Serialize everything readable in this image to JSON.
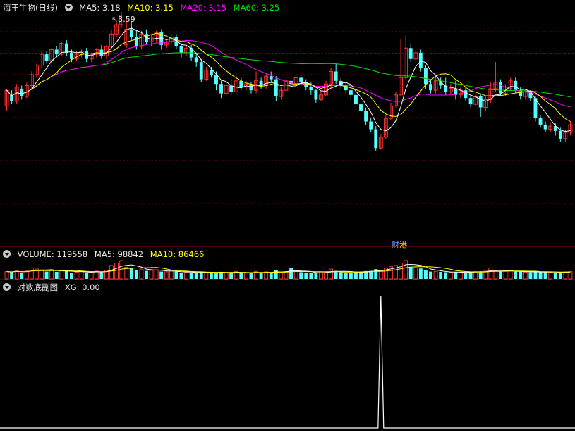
{
  "colors": {
    "background": "#000000",
    "up": "#ff3232",
    "down": "#54ffff",
    "ma5": "#ffffff",
    "ma10": "#ffff00",
    "ma20": "#ff00ff",
    "ma60": "#00e000",
    "grid": "#8a0000",
    "xg_line": "#ffffff"
  },
  "icons": {
    "panel_menu": "chevron-down-circle-icon"
  },
  "price_panel": {
    "name": "海王生物(日线)",
    "ma5": "MA5: 3.18",
    "ma10": "MA10: 3.15",
    "ma20": "MA20: 3.15",
    "ma60": "MA60: 3.25",
    "high_marker": "3.59",
    "event_tag_1": "财",
    "event_tag_2": "港"
  },
  "volume_panel": {
    "label": "VOLUME: 119558",
    "ma5": "MA5: 98842",
    "ma10": "MA10: 86466"
  },
  "indicator_panel": {
    "label": "对数底副图",
    "xg": "XG: 0.00"
  },
  "chart_data": [
    {
      "type": "candlestick",
      "ylim": [
        2.3,
        3.72
      ],
      "candles": [
        [
          3.11,
          3.21,
          3.08,
          3.22
        ],
        [
          3.18,
          3.14,
          3.12,
          3.21
        ],
        [
          3.14,
          3.23,
          3.12,
          3.25
        ],
        [
          3.22,
          3.17,
          3.15,
          3.24
        ],
        [
          3.17,
          3.24,
          3.16,
          3.26
        ],
        [
          3.24,
          3.31,
          3.22,
          3.33
        ],
        [
          3.31,
          3.37,
          3.29,
          3.38
        ],
        [
          3.37,
          3.44,
          3.35,
          3.46
        ],
        [
          3.44,
          3.4,
          3.38,
          3.46
        ],
        [
          3.4,
          3.47,
          3.38,
          3.48
        ],
        [
          3.47,
          3.44,
          3.42,
          3.49
        ],
        [
          3.44,
          3.51,
          3.43,
          3.52
        ],
        [
          3.51,
          3.45,
          3.43,
          3.53
        ],
        [
          3.45,
          3.41,
          3.39,
          3.47
        ],
        [
          3.41,
          3.44,
          3.4,
          3.46
        ],
        [
          3.44,
          3.46,
          3.42,
          3.47
        ],
        [
          3.46,
          3.41,
          3.39,
          3.48
        ],
        [
          3.41,
          3.44,
          3.39,
          3.45
        ],
        [
          3.44,
          3.47,
          3.42,
          3.48
        ],
        [
          3.47,
          3.43,
          3.41,
          3.5
        ],
        [
          3.43,
          3.49,
          3.41,
          3.5
        ],
        [
          3.49,
          3.57,
          3.48,
          3.6
        ],
        [
          3.57,
          3.63,
          3.55,
          3.65
        ],
        [
          3.63,
          3.69,
          3.61,
          3.71
        ],
        [
          3.5,
          3.6,
          3.48,
          3.67
        ],
        [
          3.6,
          3.55,
          3.53,
          3.65
        ],
        [
          3.55,
          3.49,
          3.47,
          3.59
        ],
        [
          3.49,
          3.57,
          3.47,
          3.59
        ],
        [
          3.57,
          3.52,
          3.5,
          3.6
        ],
        [
          3.52,
          3.55,
          3.49,
          3.57
        ],
        [
          3.55,
          3.58,
          3.52,
          3.59
        ],
        [
          3.58,
          3.5,
          3.47,
          3.6
        ],
        [
          3.5,
          3.52,
          3.48,
          3.54
        ],
        [
          3.52,
          3.55,
          3.5,
          3.57
        ],
        [
          3.55,
          3.49,
          3.47,
          3.57
        ],
        [
          3.49,
          3.45,
          3.42,
          3.51
        ],
        [
          3.45,
          3.48,
          3.43,
          3.5
        ],
        [
          3.48,
          3.42,
          3.4,
          3.5
        ],
        [
          3.42,
          3.39,
          3.36,
          3.44
        ],
        [
          3.39,
          3.28,
          3.26,
          3.41
        ],
        [
          3.28,
          3.34,
          3.27,
          3.36
        ],
        [
          3.34,
          3.31,
          3.29,
          3.36
        ],
        [
          3.31,
          3.25,
          3.21,
          3.33
        ],
        [
          3.25,
          3.19,
          3.16,
          3.27
        ],
        [
          3.19,
          3.24,
          3.17,
          3.26
        ],
        [
          3.24,
          3.2,
          3.18,
          3.28
        ],
        [
          3.2,
          3.27,
          3.19,
          3.3
        ],
        [
          3.27,
          3.23,
          3.21,
          3.29
        ],
        [
          3.23,
          3.25,
          3.21,
          3.27
        ],
        [
          3.25,
          3.21,
          3.19,
          3.26
        ],
        [
          3.21,
          3.27,
          3.19,
          3.33
        ],
        [
          3.27,
          3.24,
          3.22,
          3.29
        ],
        [
          3.24,
          3.3,
          3.22,
          3.32
        ],
        [
          3.3,
          3.28,
          3.26,
          3.33
        ],
        [
          3.28,
          3.17,
          3.14,
          3.3
        ],
        [
          3.17,
          3.21,
          3.15,
          3.23
        ],
        [
          3.21,
          3.27,
          3.19,
          3.29
        ],
        [
          3.27,
          3.25,
          3.23,
          3.37
        ],
        [
          3.25,
          3.29,
          3.23,
          3.31
        ],
        [
          3.29,
          3.26,
          3.24,
          3.31
        ],
        [
          3.26,
          3.23,
          3.21,
          3.28
        ],
        [
          3.23,
          3.21,
          3.18,
          3.26
        ],
        [
          3.21,
          3.15,
          3.13,
          3.22
        ],
        [
          3.15,
          3.18,
          3.14,
          3.21
        ],
        [
          3.18,
          3.25,
          3.17,
          3.27
        ],
        [
          3.25,
          3.33,
          3.23,
          3.35
        ],
        [
          3.33,
          3.27,
          3.25,
          3.38
        ],
        [
          3.27,
          3.24,
          3.22,
          3.29
        ],
        [
          3.24,
          3.21,
          3.19,
          3.26
        ],
        [
          3.21,
          3.18,
          3.15,
          3.24
        ],
        [
          3.18,
          3.12,
          3.1,
          3.2
        ],
        [
          3.12,
          3.08,
          3.06,
          3.14
        ],
        [
          3.08,
          3.01,
          2.99,
          3.1
        ],
        [
          3.01,
          2.96,
          2.94,
          3.03
        ],
        [
          2.96,
          2.84,
          2.82,
          2.98
        ],
        [
          2.84,
          2.91,
          2.83,
          2.93
        ],
        [
          2.91,
          3.03,
          2.9,
          3.05
        ],
        [
          3.03,
          3.11,
          3.02,
          3.13
        ],
        [
          3.11,
          3.18,
          3.1,
          3.2
        ],
        [
          3.18,
          3.29,
          3.17,
          3.54
        ],
        [
          3.29,
          3.48,
          3.28,
          3.56
        ],
        [
          3.48,
          3.41,
          3.39,
          3.51
        ],
        [
          3.41,
          3.45,
          3.39,
          3.47
        ],
        [
          3.45,
          3.35,
          3.33,
          3.47
        ],
        [
          3.35,
          3.25,
          3.22,
          3.37
        ],
        [
          3.25,
          3.21,
          3.19,
          3.28
        ],
        [
          3.21,
          3.27,
          3.19,
          3.3
        ],
        [
          3.27,
          3.24,
          3.22,
          3.29
        ],
        [
          3.24,
          3.2,
          3.18,
          3.29
        ],
        [
          3.2,
          3.22,
          3.18,
          3.25
        ],
        [
          3.22,
          3.18,
          3.15,
          3.27
        ],
        [
          3.18,
          3.21,
          3.16,
          3.23
        ],
        [
          3.21,
          3.16,
          3.14,
          3.23
        ],
        [
          3.16,
          3.12,
          3.1,
          3.18
        ],
        [
          3.12,
          3.17,
          3.11,
          3.19
        ],
        [
          3.17,
          3.1,
          3.04,
          3.19
        ],
        [
          3.1,
          3.15,
          3.08,
          3.17
        ],
        [
          3.15,
          3.22,
          3.13,
          3.26
        ],
        [
          3.22,
          3.26,
          3.2,
          3.39
        ],
        [
          3.26,
          3.19,
          3.17,
          3.28
        ],
        [
          3.19,
          3.23,
          3.17,
          3.25
        ],
        [
          3.23,
          3.27,
          3.21,
          3.29
        ],
        [
          3.27,
          3.21,
          3.19,
          3.29
        ],
        [
          3.21,
          3.17,
          3.15,
          3.23
        ],
        [
          3.17,
          3.2,
          3.15,
          3.22
        ],
        [
          3.2,
          3.16,
          3.14,
          3.21
        ],
        [
          3.16,
          3.03,
          3.01,
          3.17
        ],
        [
          3.03,
          2.99,
          2.97,
          3.05
        ],
        [
          2.99,
          2.96,
          2.94,
          3.01
        ],
        [
          2.96,
          2.98,
          2.94,
          3.0
        ],
        [
          2.98,
          2.95,
          2.92,
          3.0
        ],
        [
          2.95,
          2.9,
          2.88,
          2.97
        ],
        [
          2.9,
          2.94,
          2.88,
          2.96
        ],
        [
          2.94,
          2.99,
          2.92,
          3.01
        ]
      ],
      "high_marker_value": 3.59
    },
    {
      "type": "bar",
      "name": "VOLUME",
      "values": [
        60,
        55,
        70,
        50,
        65,
        90,
        80,
        75,
        60,
        72,
        58,
        66,
        70,
        50,
        55,
        60,
        52,
        58,
        64,
        55,
        70,
        110,
        130,
        150,
        95,
        90,
        70,
        80,
        66,
        70,
        75,
        60,
        58,
        64,
        60,
        52,
        55,
        50,
        48,
        60,
        52,
        48,
        55,
        58,
        50,
        52,
        60,
        50,
        48,
        46,
        62,
        50,
        58,
        52,
        70,
        55,
        60,
        90,
        62,
        55,
        50,
        48,
        46,
        52,
        60,
        80,
        66,
        54,
        50,
        52,
        60,
        58,
        64,
        66,
        80,
        70,
        90,
        100,
        110,
        130,
        150,
        100,
        90,
        85,
        70,
        60,
        62,
        58,
        55,
        52,
        55,
        56,
        54,
        58,
        60,
        62,
        64,
        90,
        66,
        60,
        62,
        66,
        60,
        58,
        55,
        56,
        60,
        58,
        55,
        54,
        52,
        55,
        58,
        60
      ],
      "ma5": 98842,
      "ma10": 86466,
      "last": 119558
    },
    {
      "type": "line",
      "name": "XG",
      "spike_index": 75,
      "spike_value": 1.0,
      "last": 0.0
    }
  ]
}
